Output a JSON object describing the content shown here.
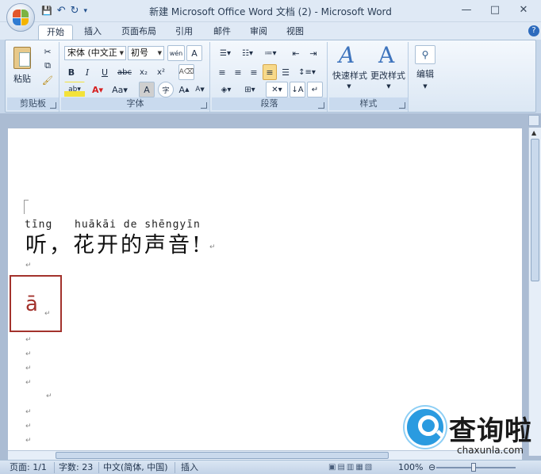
{
  "window": {
    "title": "新建 Microsoft Office Word 文档 (2) - Microsoft Word",
    "controls": [
      "—",
      "□",
      "✕"
    ]
  },
  "quick_access": {
    "save": "💾",
    "undo": "↶",
    "redo": "↻",
    "more": "▾"
  },
  "tabs": [
    "开始",
    "插入",
    "页面布局",
    "引用",
    "邮件",
    "审阅",
    "视图"
  ],
  "active_tab": "开始",
  "ribbon": {
    "clipboard": {
      "label": "剪贴板",
      "paste": "粘贴"
    },
    "font": {
      "label": "字体",
      "font_name": "宋体 (中文正",
      "font_size": "初号",
      "wen": "wén",
      "a_box": "A",
      "bold": "B",
      "italic": "I",
      "underline": "U",
      "strike": "abc",
      "sub": "x₂",
      "sup": "x²",
      "change_case": "Aa",
      "char_shading": "A",
      "enclose": "字",
      "grow": "A",
      "shrink": "A"
    },
    "paragraph": {
      "label": "段落"
    },
    "styles": {
      "label": "样式",
      "quick_styles": "快速样式",
      "change_styles": "更改样式"
    },
    "editing": {
      "label": "编辑"
    }
  },
  "document": {
    "pinyin_1": "tīng",
    "pinyin_2": "huākāi de shēngyīn",
    "text": "听，花开的声音!",
    "highlight_char": "ā",
    "mark": "↵"
  },
  "statusbar": {
    "page": "页面: 1/1",
    "words": "字数: 23",
    "language": "中文(简体, 中国)",
    "mode": "插入",
    "zoom": "100%"
  },
  "watermark": {
    "text": "查询啦",
    "domain": "chaxunla.com"
  },
  "colors": {
    "accent": "#a3322c",
    "ribbon": "#dbe7f4",
    "watermark": "#2a9be0"
  }
}
